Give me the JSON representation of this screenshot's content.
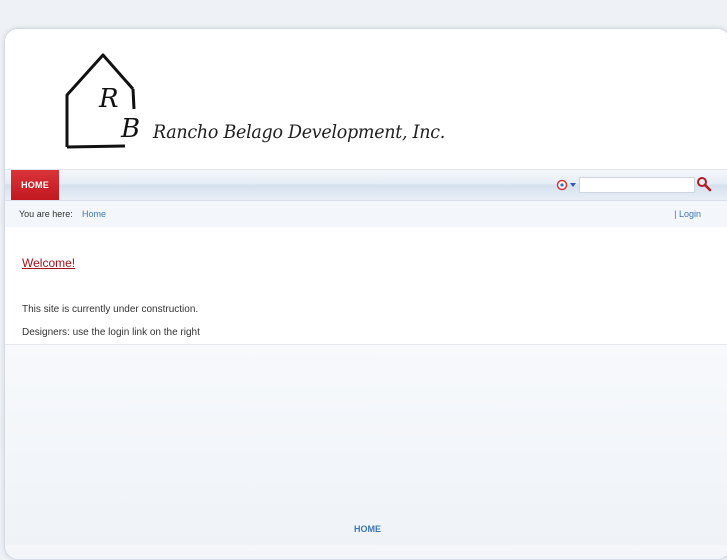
{
  "header": {
    "site_title": "Rancho Belago Development, Inc.",
    "logo_letters": "RB"
  },
  "nav": {
    "home_label": "HOME"
  },
  "search": {
    "value": "",
    "placeholder": ""
  },
  "breadcrumb": {
    "label": "You are here:",
    "current": "Home",
    "separator": "|",
    "login_label": "Login"
  },
  "content": {
    "heading": "Welcome!",
    "paragraph1": "This site is currently under construction.",
    "paragraph2": "Designers: use the login link on the right"
  },
  "footer": {
    "home_label": "HOME"
  },
  "colors": {
    "accent_red": "#c2181f",
    "link_blue": "#3d78b8",
    "heading_red": "#a5121c"
  },
  "icons": {
    "search": "magnifier-icon",
    "search_engine": "search-engine-dropdown-icon"
  }
}
